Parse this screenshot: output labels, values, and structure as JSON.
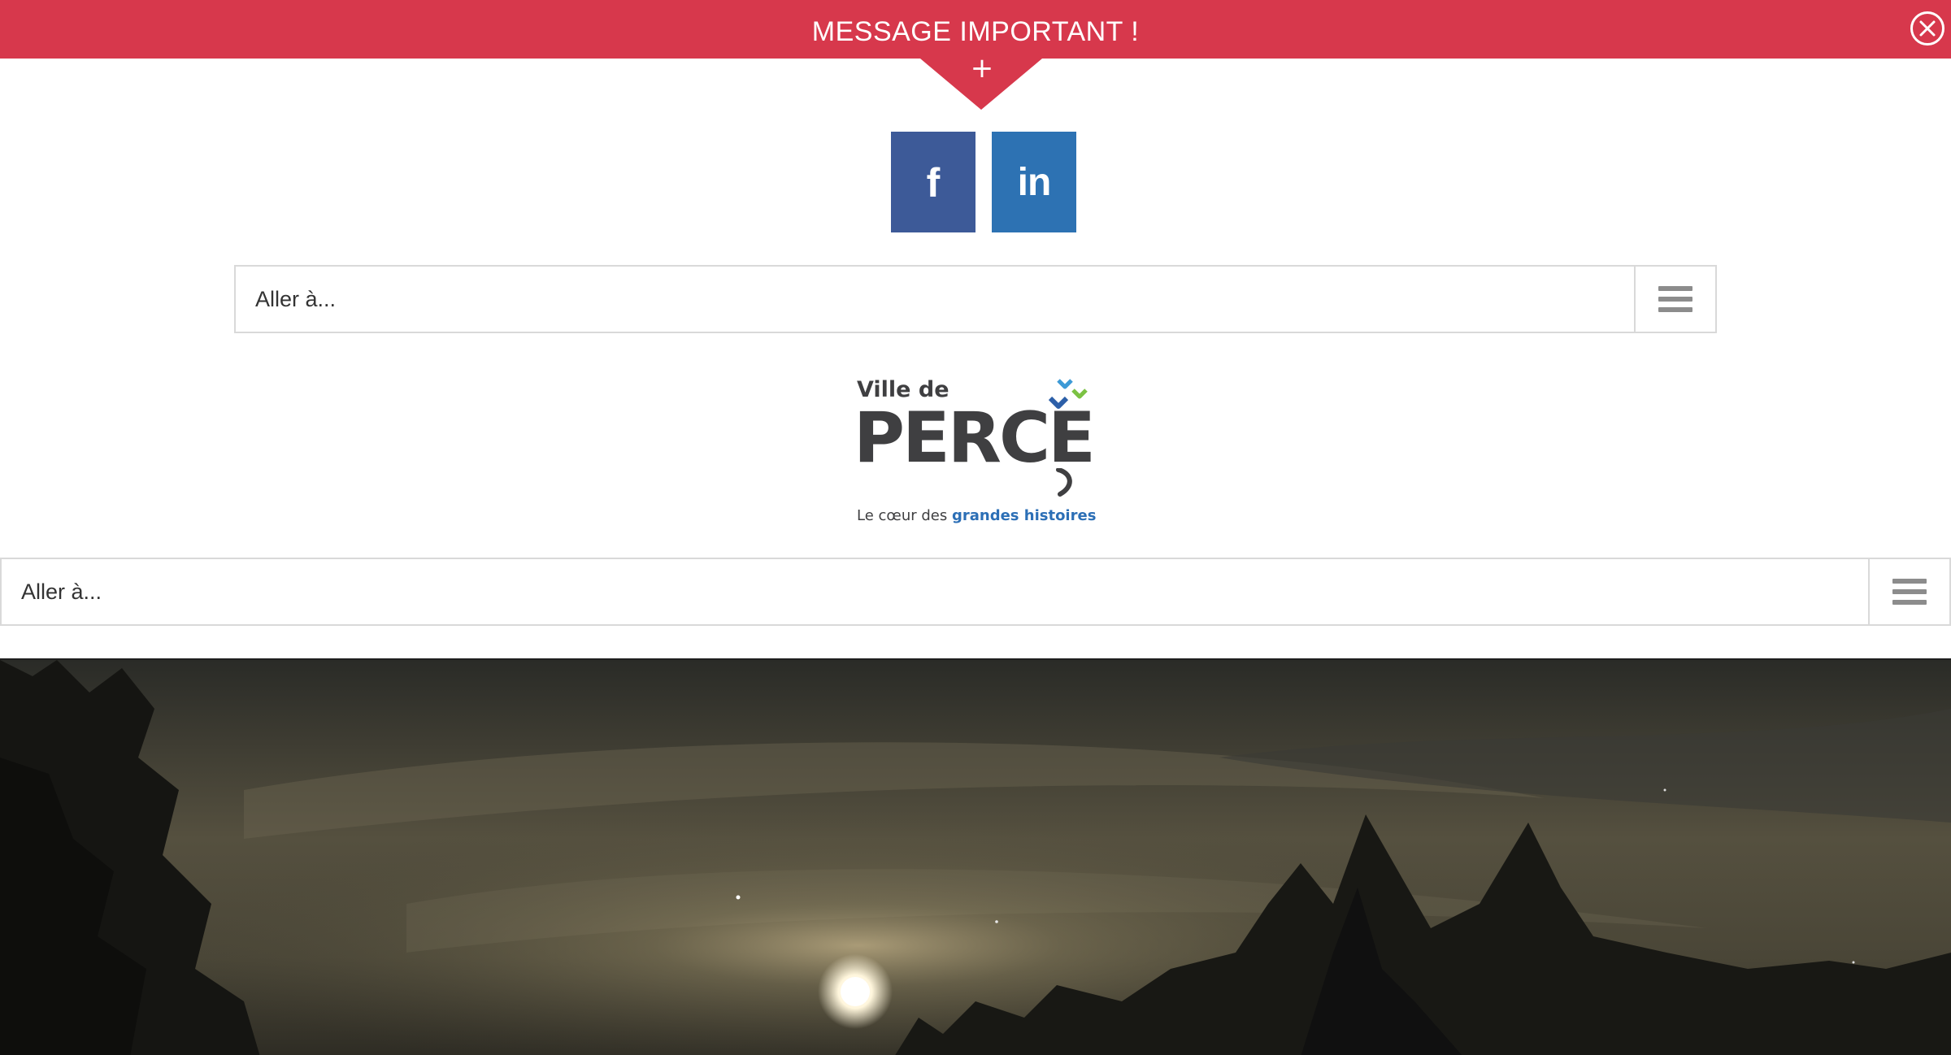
{
  "alert": {
    "title": "MESSAGE IMPORTANT !",
    "toggle_label": "+",
    "bg_color": "#d7384c"
  },
  "social": {
    "facebook_label": "f",
    "linkedin_label": "in",
    "facebook_color": "#3d5a98",
    "linkedin_color": "#2d72b3"
  },
  "top_nav": {
    "label": "Aller à...",
    "icon": "hamburger-icon"
  },
  "logo": {
    "line1": "Ville de",
    "line2": "PERCE",
    "tagline_plain": "Le cœur des",
    "tagline_accent": "grandes histoires"
  },
  "main_nav": {
    "label": "Aller à...",
    "icon": "hamburger-icon"
  },
  "hero": {
    "image": "night-sky-moon-forest-photo"
  }
}
